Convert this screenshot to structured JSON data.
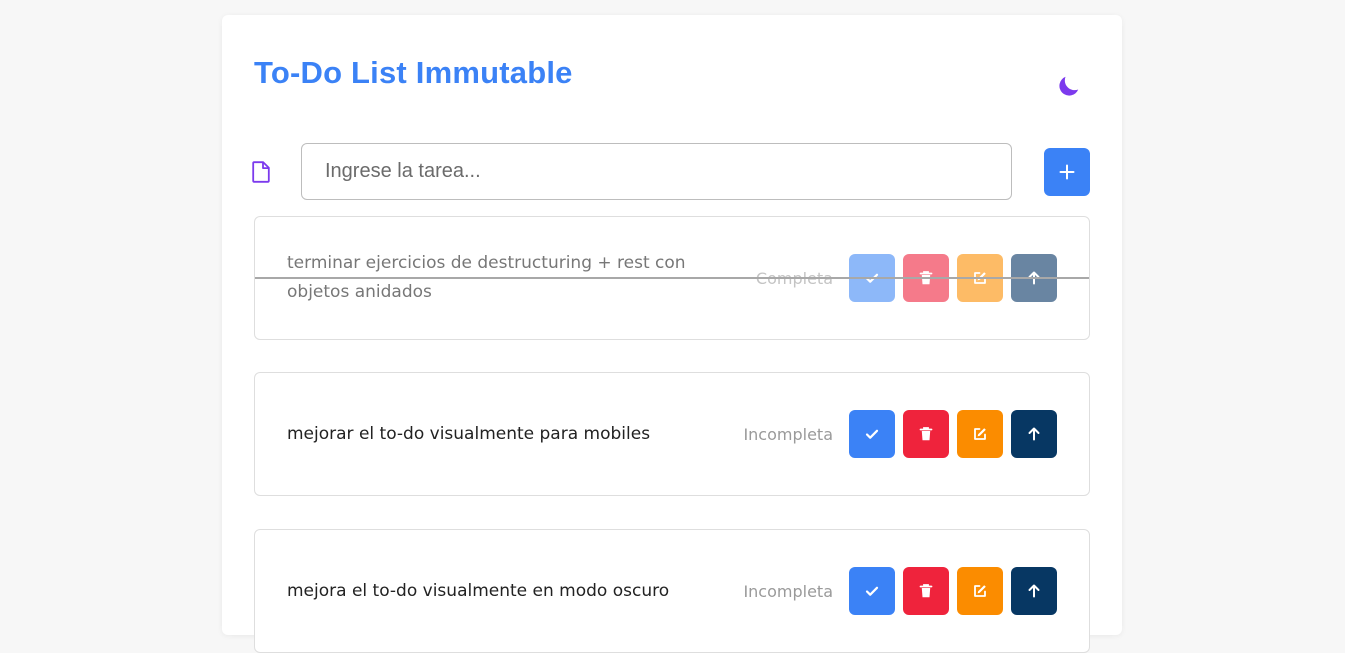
{
  "app": {
    "title": "To-Do List Immutable",
    "theme_toggle_icon": "moon-icon"
  },
  "form": {
    "input_placeholder": "Ingrese la tarea...",
    "input_value": "",
    "input_icon": "file-icon",
    "add_button_label": "+"
  },
  "tasks": [
    {
      "text": "terminar ejercicios de destructuring + rest con objetos anidados",
      "status": "Completa",
      "completed": true
    },
    {
      "text": "mejorar el to-do visualmente para mobiles",
      "status": "Incompleta",
      "completed": false
    },
    {
      "text": "mejora el to-do visualmente en modo oscuro",
      "status": "Incompleta",
      "completed": false
    }
  ],
  "task_action_icons": [
    "check-icon",
    "trash-icon",
    "edit-icon",
    "arrow-up-icon"
  ],
  "colors": {
    "accent": "#3b82f6",
    "theme_toggle": "#7c3aed",
    "complete_button": "#3b82f6",
    "delete_button": "#ef233c",
    "edit_button": "#fb8c00",
    "move_up_button": "#073763"
  }
}
